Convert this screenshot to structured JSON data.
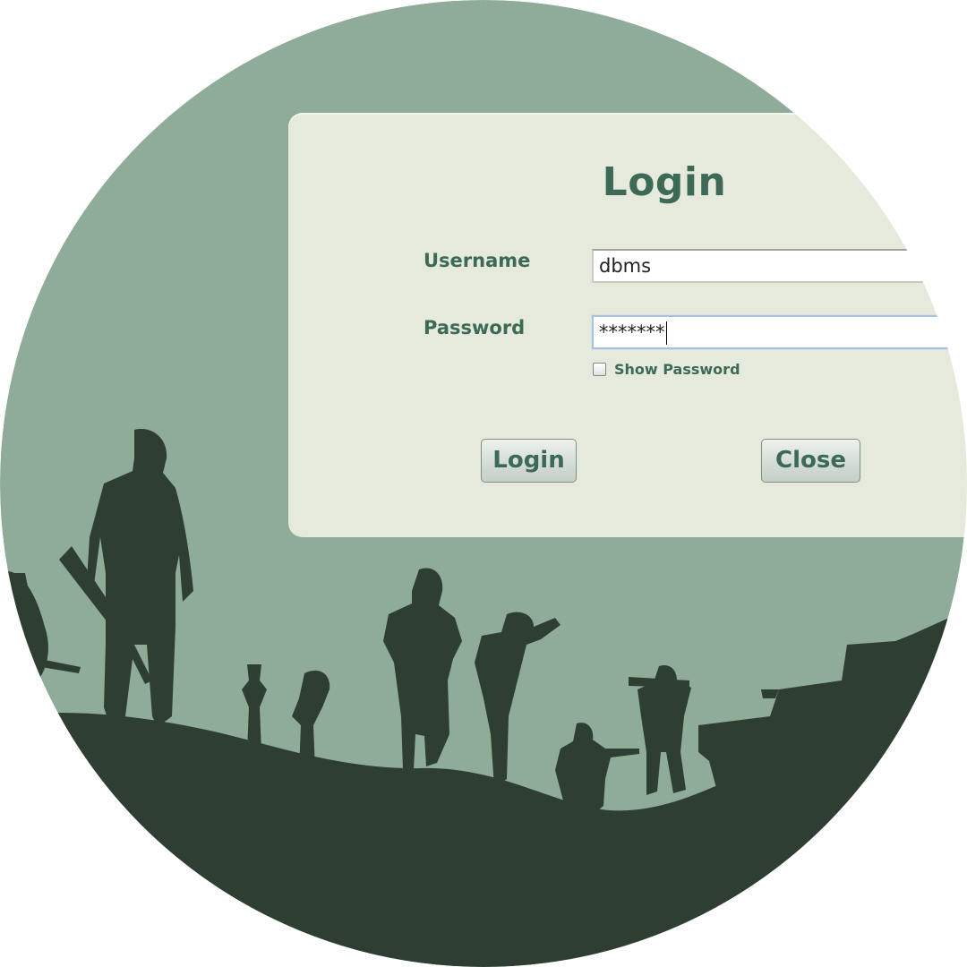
{
  "dialog": {
    "title": "Login",
    "username_label": "Username",
    "username_value": "dbms",
    "password_label": "Password",
    "password_value": "*******",
    "show_password_label": "Show Password",
    "show_password_checked": false,
    "login_button": "Login",
    "close_button": "Close"
  },
  "background": {
    "image": "soldiers-silhouette-scene",
    "colors": {
      "sky": "#8fac99",
      "silhouette": "#2f3e33",
      "panel": "#e6eadd",
      "accent_text": "#3d6a57"
    }
  }
}
